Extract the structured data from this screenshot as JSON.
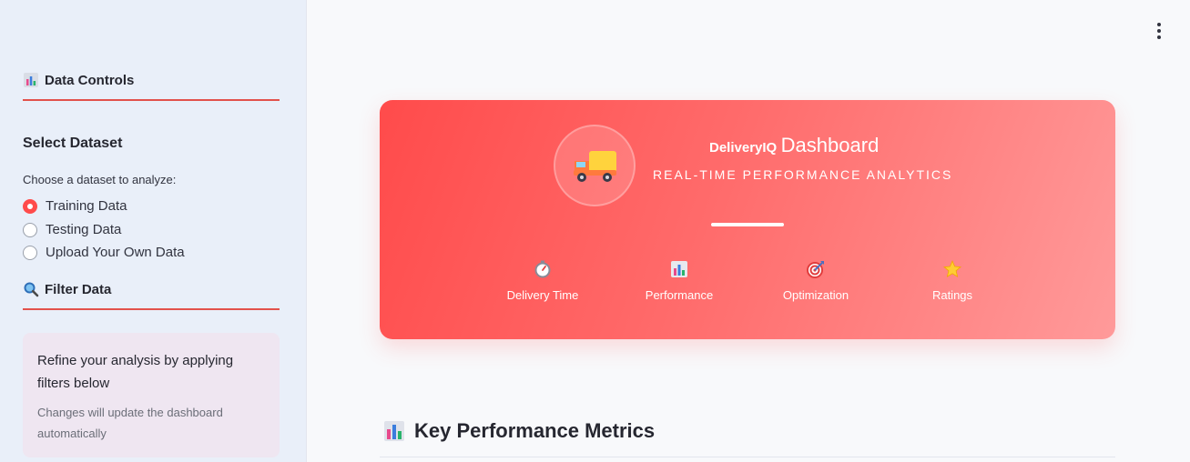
{
  "sidebar": {
    "data_controls": {
      "icon": "bar-chart-icon",
      "label": "Data Controls"
    },
    "select_dataset": {
      "title": "Select Dataset",
      "help": "Choose a dataset to analyze:",
      "options": [
        {
          "label": "Training Data",
          "selected": true
        },
        {
          "label": "Testing Data",
          "selected": false
        },
        {
          "label": "Upload Your Own Data",
          "selected": false
        }
      ]
    },
    "filter_data": {
      "icon": "magnifier-icon",
      "label": "Filter Data"
    },
    "info": {
      "main": "Refine your analysis by applying filters below",
      "sub": "Changes will update the dashboard automatically"
    }
  },
  "hero": {
    "logo_icon": "delivery-truck-icon",
    "brand": "DeliveryIQ",
    "title": "Dashboard",
    "subtitle": "REAL-TIME PERFORMANCE ANALYTICS",
    "features": [
      {
        "icon": "stopwatch-icon",
        "label": "Delivery Time"
      },
      {
        "icon": "bar-chart-icon",
        "label": "Performance"
      },
      {
        "icon": "target-icon",
        "label": "Optimization"
      },
      {
        "icon": "star-icon",
        "label": "Ratings"
      }
    ]
  },
  "main": {
    "section_title": "Key Performance Metrics",
    "section_icon": "bar-chart-icon"
  },
  "colors": {
    "accent": "#ff4b4b",
    "sidebar_bg": "#e9eff9",
    "info_bg": "#efe6f1"
  }
}
